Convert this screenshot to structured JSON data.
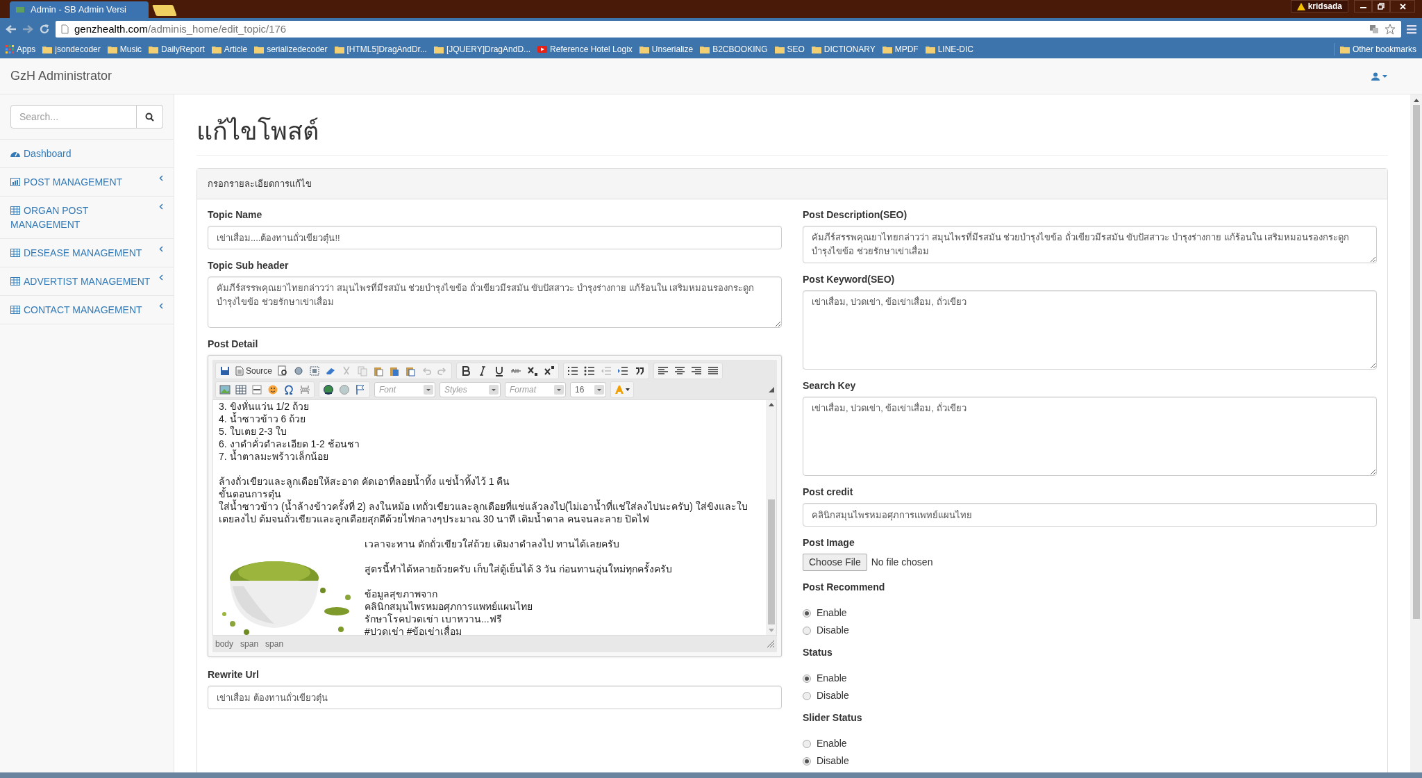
{
  "browser": {
    "tab_title": "Admin - SB Admin Versi",
    "user": "kridsada",
    "url_host": "genzhealth.com",
    "url_path": "/adminis_home/edit_topic/176",
    "bookmarks": [
      {
        "label": "Apps",
        "kind": "apps"
      },
      {
        "label": "jsondecoder",
        "kind": "folder"
      },
      {
        "label": "Music",
        "kind": "folder"
      },
      {
        "label": "DailyReport",
        "kind": "folder"
      },
      {
        "label": "Article",
        "kind": "folder"
      },
      {
        "label": "serializedecoder",
        "kind": "folder"
      },
      {
        "label": "[HTML5]DragAndDr...",
        "kind": "folder"
      },
      {
        "label": "[JQUERY]DragAndD...",
        "kind": "folder"
      },
      {
        "label": "Reference Hotel Logix",
        "kind": "video"
      },
      {
        "label": "Unserialize",
        "kind": "folder"
      },
      {
        "label": "B2CBOOKING",
        "kind": "folder"
      },
      {
        "label": "SEO",
        "kind": "folder"
      },
      {
        "label": "DICTIONARY",
        "kind": "folder"
      },
      {
        "label": "MPDF",
        "kind": "folder"
      },
      {
        "label": "LINE-DIC",
        "kind": "folder"
      }
    ],
    "other_bookmarks": "Other bookmarks"
  },
  "app": {
    "brand": "GzH Administrator"
  },
  "sidebar": {
    "search_placeholder": "Search...",
    "items": [
      {
        "label": "Dashboard",
        "kind": "dashboard",
        "expandable": false
      },
      {
        "label": "POST MANAGEMENT",
        "kind": "chart",
        "expandable": true
      },
      {
        "label": "ORGAN POST MANAGEMENT",
        "kind": "table",
        "expandable": true
      },
      {
        "label": "DESEASE MANAGEMENT",
        "kind": "table",
        "expandable": true
      },
      {
        "label": "ADVERTIST MANAGEMENT",
        "kind": "table",
        "expandable": true
      },
      {
        "label": "CONTACT MANAGEMENT",
        "kind": "table",
        "expandable": true
      }
    ]
  },
  "page": {
    "title": "แก้ไขโพสต์",
    "panel_heading": "กรอกรายละเอียดการแก้ไข"
  },
  "left_fields": [
    {
      "kind": "input",
      "label": "Topic Name",
      "value": "เข่าเสื่อม....ต้องทานถั่วเขียวตุ๋น!!"
    },
    {
      "kind": "textarea",
      "label": "Topic Sub header",
      "value": "คัมภีร์สรรพคุณยาไทยกล่าวว่า สมุนไพรที่มีรสมัน ช่วยบำรุงไขข้อ ถั่วเขียวมีรสมัน ขับปัสสาวะ บำรุงร่างกาย แก้ร้อนใน เสริมหมอนรองกระดูก บำรุงไขข้อ ช่วยรักษาเข่าเสื่อม"
    }
  ],
  "editor": {
    "label": "Post Detail",
    "source": "Source",
    "dropdowns": [
      "Font",
      "Styles",
      "Format",
      "16"
    ],
    "blocks": [
      [
        "3. ขิงหั่นแว่น 1/2 ถ้วย",
        "4. น้ำซาวข้าว 6 ถ้วย",
        "5. ใบเตย 2-3 ใบ",
        "6. งาดำคั่วตำละเอียด 1-2 ช้อนชา",
        "7. น้ำตาลมะพร้าวเล็กน้อย"
      ],
      [
        "ล้างถั่วเขียวและลูกเดือยให้สะอาด คัดเอาที่ลอยน้ำทิ้ง แช่น้ำทิ้งไว้ 1 คืน",
        "ขั้นตอนการตุ๋น",
        "ใส่น้ำซาวข้าว (น้ำล้างข้าวครั้งที่ 2) ลงในหม้อ เทถั่วเขียวและลูกเดือยที่แช่แล้วลงไป(ไม่เอาน้ำที่แช่ใส่ลงไปนะครับ) ใส่ขิงและใบเตยลงไป ต้มจนถั่วเขียวและลูกเดือยสุกดีด้วยไฟกลางๆประมาณ 30 นาที เติมน้ำตาล คนจนละลาย ปิดไฟ"
      ]
    ],
    "caption_blocks": [
      [
        "เวลาจะทาน ตักถั่วเขียวใส่ถ้วย เติมงาดำลงไป ทานได้เลยครับ"
      ],
      [
        "สูตรนี้ทำได้หลายถ้วยครับ เก็บใส่ตู้เย็นได้ 3 วัน ก่อนทานอุ่นใหม่ทุกครั้งครับ"
      ],
      [
        "ข้อมูลสุขภาพจาก",
        "คลินิกสมุนไพรหมอศุภการแพทย์แผนไทย",
        "รักษาโรคปวดเข่า เบาหวาน...ฟรี",
        "#ปวดเข่า #ข้อเข่าเสื่อม"
      ]
    ],
    "path": [
      "body",
      "span",
      "span"
    ]
  },
  "rewrite": {
    "label": "Rewrite Url",
    "value": "เข่าเสื่อม ต้องทานถั่วเขียวตุ๋น"
  },
  "right_fields": [
    {
      "kind": "textarea",
      "label": "Post Description(SEO)",
      "value": "คัมภีร์สรรพคุณยาไทยกล่าวว่า สมุนไพรที่มีรสมัน ช่วยบำรุงไขข้อ ถั่วเขียวมีรสมัน ขับปัสสาวะ บำรุงร่างกาย แก้ร้อนใน เสริมหมอนรองกระดูก บำรุงไขข้อ ช่วยรักษาเข่าเสื่อม"
    },
    {
      "kind": "textarea",
      "label": "Post Keyword(SEO)",
      "value": "เข่าเสื่อม, ปวดเข่า, ข้อเข่าเสื่อม, ถั่วเขียว"
    },
    {
      "kind": "textarea",
      "label": "Search Key",
      "value": "เข่าเสื่อม, ปวดเข่า, ข้อเข่าเสื่อม, ถั่วเขียว"
    },
    {
      "kind": "input",
      "label": "Post credit",
      "value": "คลินิกสมุนไพรหมอศุภการแพทย์แผนไทย"
    },
    {
      "kind": "file",
      "label": "Post Image",
      "button": "Choose File",
      "status": "No file chosen"
    },
    {
      "kind": "radio",
      "label": "Post Recommend",
      "options": [
        {
          "label": "Enable",
          "selected": true
        },
        {
          "label": "Disable",
          "selected": false
        }
      ]
    },
    {
      "kind": "radio",
      "label": "Status",
      "options": [
        {
          "label": "Enable",
          "selected": true
        },
        {
          "label": "Disable",
          "selected": false
        }
      ]
    },
    {
      "kind": "radio",
      "label": "Slider Status",
      "options": [
        {
          "label": "Enable",
          "selected": false
        },
        {
          "label": "Disable",
          "selected": true
        }
      ]
    }
  ]
}
